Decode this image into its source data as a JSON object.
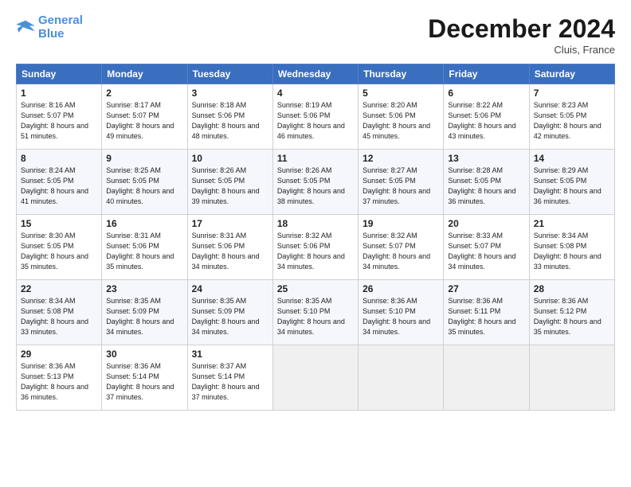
{
  "logo": {
    "line1": "General",
    "line2": "Blue"
  },
  "title": "December 2024",
  "location": "Cluis, France",
  "weekdays": [
    "Sunday",
    "Monday",
    "Tuesday",
    "Wednesday",
    "Thursday",
    "Friday",
    "Saturday"
  ],
  "weeks": [
    [
      {
        "day": "1",
        "sunrise": "8:16 AM",
        "sunset": "5:07 PM",
        "daylight": "8 hours and 51 minutes."
      },
      {
        "day": "2",
        "sunrise": "8:17 AM",
        "sunset": "5:07 PM",
        "daylight": "8 hours and 49 minutes."
      },
      {
        "day": "3",
        "sunrise": "8:18 AM",
        "sunset": "5:06 PM",
        "daylight": "8 hours and 48 minutes."
      },
      {
        "day": "4",
        "sunrise": "8:19 AM",
        "sunset": "5:06 PM",
        "daylight": "8 hours and 46 minutes."
      },
      {
        "day": "5",
        "sunrise": "8:20 AM",
        "sunset": "5:06 PM",
        "daylight": "8 hours and 45 minutes."
      },
      {
        "day": "6",
        "sunrise": "8:22 AM",
        "sunset": "5:06 PM",
        "daylight": "8 hours and 43 minutes."
      },
      {
        "day": "7",
        "sunrise": "8:23 AM",
        "sunset": "5:05 PM",
        "daylight": "8 hours and 42 minutes."
      }
    ],
    [
      {
        "day": "8",
        "sunrise": "8:24 AM",
        "sunset": "5:05 PM",
        "daylight": "8 hours and 41 minutes."
      },
      {
        "day": "9",
        "sunrise": "8:25 AM",
        "sunset": "5:05 PM",
        "daylight": "8 hours and 40 minutes."
      },
      {
        "day": "10",
        "sunrise": "8:26 AM",
        "sunset": "5:05 PM",
        "daylight": "8 hours and 39 minutes."
      },
      {
        "day": "11",
        "sunrise": "8:26 AM",
        "sunset": "5:05 PM",
        "daylight": "8 hours and 38 minutes."
      },
      {
        "day": "12",
        "sunrise": "8:27 AM",
        "sunset": "5:05 PM",
        "daylight": "8 hours and 37 minutes."
      },
      {
        "day": "13",
        "sunrise": "8:28 AM",
        "sunset": "5:05 PM",
        "daylight": "8 hours and 36 minutes."
      },
      {
        "day": "14",
        "sunrise": "8:29 AM",
        "sunset": "5:05 PM",
        "daylight": "8 hours and 36 minutes."
      }
    ],
    [
      {
        "day": "15",
        "sunrise": "8:30 AM",
        "sunset": "5:05 PM",
        "daylight": "8 hours and 35 minutes."
      },
      {
        "day": "16",
        "sunrise": "8:31 AM",
        "sunset": "5:06 PM",
        "daylight": "8 hours and 35 minutes."
      },
      {
        "day": "17",
        "sunrise": "8:31 AM",
        "sunset": "5:06 PM",
        "daylight": "8 hours and 34 minutes."
      },
      {
        "day": "18",
        "sunrise": "8:32 AM",
        "sunset": "5:06 PM",
        "daylight": "8 hours and 34 minutes."
      },
      {
        "day": "19",
        "sunrise": "8:32 AM",
        "sunset": "5:07 PM",
        "daylight": "8 hours and 34 minutes."
      },
      {
        "day": "20",
        "sunrise": "8:33 AM",
        "sunset": "5:07 PM",
        "daylight": "8 hours and 34 minutes."
      },
      {
        "day": "21",
        "sunrise": "8:34 AM",
        "sunset": "5:08 PM",
        "daylight": "8 hours and 33 minutes."
      }
    ],
    [
      {
        "day": "22",
        "sunrise": "8:34 AM",
        "sunset": "5:08 PM",
        "daylight": "8 hours and 33 minutes."
      },
      {
        "day": "23",
        "sunrise": "8:35 AM",
        "sunset": "5:09 PM",
        "daylight": "8 hours and 34 minutes."
      },
      {
        "day": "24",
        "sunrise": "8:35 AM",
        "sunset": "5:09 PM",
        "daylight": "8 hours and 34 minutes."
      },
      {
        "day": "25",
        "sunrise": "8:35 AM",
        "sunset": "5:10 PM",
        "daylight": "8 hours and 34 minutes."
      },
      {
        "day": "26",
        "sunrise": "8:36 AM",
        "sunset": "5:10 PM",
        "daylight": "8 hours and 34 minutes."
      },
      {
        "day": "27",
        "sunrise": "8:36 AM",
        "sunset": "5:11 PM",
        "daylight": "8 hours and 35 minutes."
      },
      {
        "day": "28",
        "sunrise": "8:36 AM",
        "sunset": "5:12 PM",
        "daylight": "8 hours and 35 minutes."
      }
    ],
    [
      {
        "day": "29",
        "sunrise": "8:36 AM",
        "sunset": "5:13 PM",
        "daylight": "8 hours and 36 minutes."
      },
      {
        "day": "30",
        "sunrise": "8:36 AM",
        "sunset": "5:14 PM",
        "daylight": "8 hours and 37 minutes."
      },
      {
        "day": "31",
        "sunrise": "8:37 AM",
        "sunset": "5:14 PM",
        "daylight": "8 hours and 37 minutes."
      },
      null,
      null,
      null,
      null
    ]
  ],
  "labels": {
    "sunrise_prefix": "Sunrise: ",
    "sunset_prefix": "Sunset: ",
    "daylight_prefix": "Daylight: "
  }
}
